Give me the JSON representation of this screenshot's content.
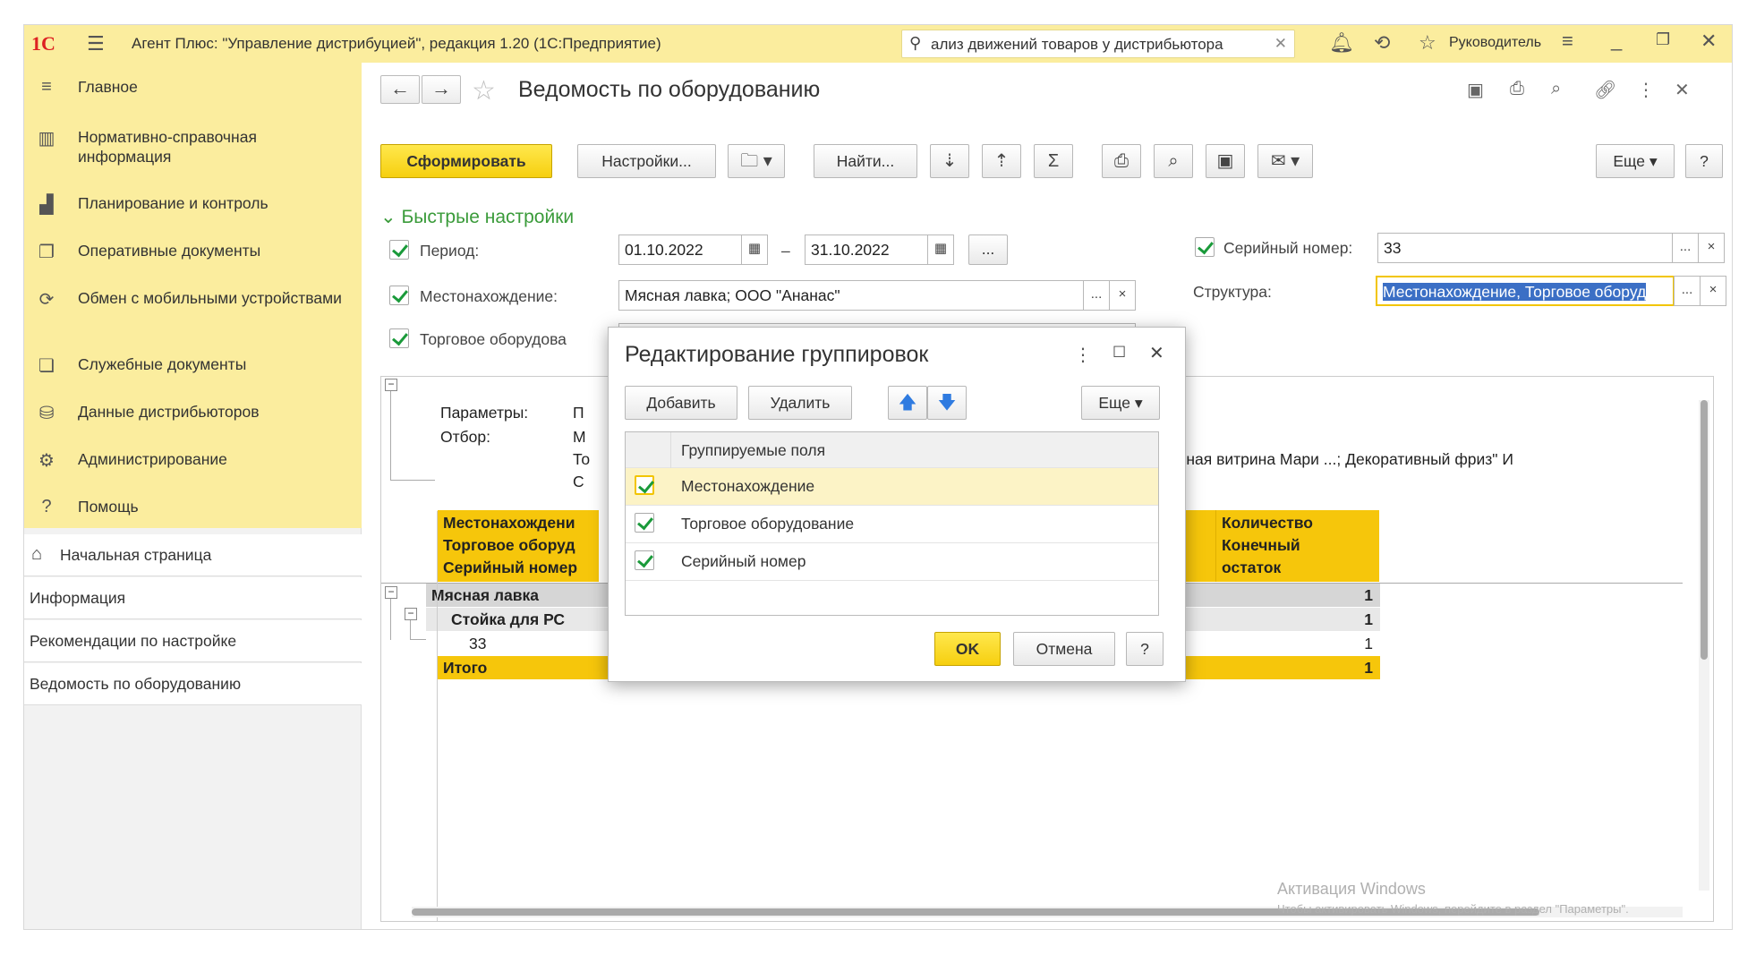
{
  "titlebar": {
    "logo": "1С",
    "app_title": "Агент Плюс: \"Управление дистрибуцией\", редакция 1.20  (1С:Предприятие)",
    "search_value": "ализ движений товаров у дистрибьютора",
    "user": "Руководитель"
  },
  "sidebar": {
    "menu": [
      {
        "label": "Главное",
        "icon": "hamburger-icon"
      },
      {
        "label": "Нормативно-справочная информация",
        "icon": "books-icon"
      },
      {
        "label": "Планирование и контроль",
        "icon": "bar-chart-icon"
      },
      {
        "label": "Оперативные документы",
        "icon": "documents-icon"
      },
      {
        "label": "Обмен с мобильными устройствами",
        "icon": "sync-icon"
      },
      {
        "label": "Служебные документы",
        "icon": "service-docs-icon"
      },
      {
        "label": "Данные дистрибьюторов",
        "icon": "distributor-icon"
      },
      {
        "label": "Администрирование",
        "icon": "gear-icon"
      },
      {
        "label": "Помощь",
        "icon": "question-icon"
      }
    ],
    "open_windows": [
      {
        "label": "Начальная страница"
      },
      {
        "label": "Информация"
      },
      {
        "label": "Рекомендации по настройке"
      },
      {
        "label": "Ведомость по оборудованию"
      }
    ]
  },
  "form": {
    "title": "Ведомость по оборудованию",
    "toolbar": {
      "generate": "Сформировать",
      "settings": "Настройки...",
      "find": "Найти...",
      "more": "Еще",
      "help": "?"
    },
    "quick_settings": {
      "label": "Быстрые настройки",
      "period_label": "Период:",
      "period_from": "01.10.2022",
      "period_dash": "–",
      "period_to": "31.10.2022",
      "period_btn": "...",
      "location_label": "Местонахождение:",
      "location_value": "Мясная лавка; ООО \"Ананас\"",
      "equipment_label": "Торговое оборудова",
      "serial_label": "Серийный номер:",
      "serial_value": "33",
      "structure_label": "Структура:",
      "structure_value": "Местонахождение, Торговое оборуд",
      "dots": "...",
      "clear": "×"
    }
  },
  "report": {
    "params_label": "Параметры:",
    "params_value": "П",
    "filter_label": "Отбор:",
    "filter_line1": "М",
    "filter_line2": "То",
    "filter_line3": "С",
    "filter_right": "льная витрина Мари ...; Декоративный фриз\" И",
    "header_col1": [
      "Местонахождени",
      "Торговое оборуд",
      "Серийный номер"
    ],
    "header_col2": [
      "Количество",
      "Конечный",
      "остаток"
    ],
    "rows": [
      {
        "name": "Мясная лавка",
        "qty": "1"
      },
      {
        "name": "Стойка для РС",
        "qty": "1"
      },
      {
        "name": "33",
        "qty": "1"
      },
      {
        "name": "Итого",
        "qty": "1"
      }
    ]
  },
  "dialog": {
    "title": "Редактирование группировок",
    "add": "Добавить",
    "delete": "Удалить",
    "more": "Еще",
    "column_header": "Группируемые поля",
    "items": [
      {
        "label": "Местонахождение",
        "checked": true
      },
      {
        "label": "Торговое оборудование",
        "checked": true
      },
      {
        "label": "Серийный номер",
        "checked": true
      }
    ],
    "ok": "OK",
    "cancel": "Отмена",
    "help": "?"
  },
  "watermark": {
    "title": "Активация Windows",
    "subtitle": "Чтобы активировать Windows, перейдите в раздел \"Параметры\"."
  },
  "colors": {
    "accent_yellow": "#fbed9e",
    "button_yellow": "#f6cf0f",
    "green": "#3a9b3a",
    "header_orange": "#f6c60b"
  }
}
